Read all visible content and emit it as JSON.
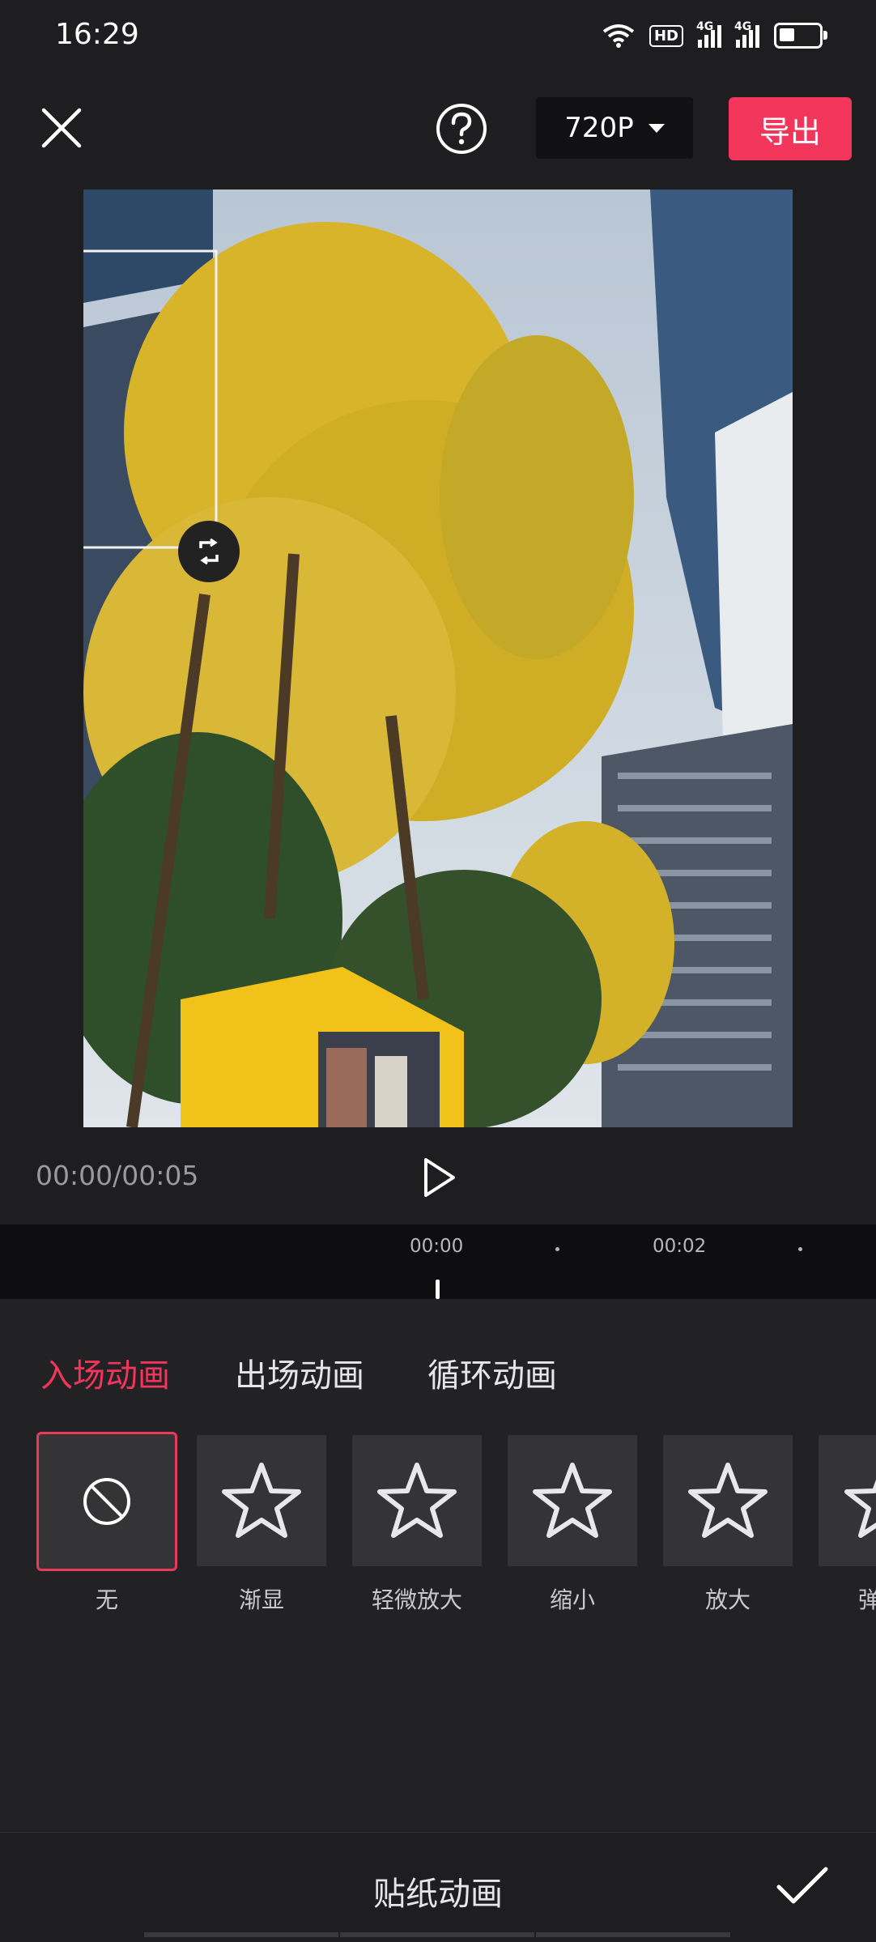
{
  "status_bar": {
    "time": "16:29",
    "hd_label": "HD",
    "signal_label": "4G"
  },
  "toolbar": {
    "quality": "720P",
    "export_label": "导出"
  },
  "player": {
    "time_display": "00:00/00:05"
  },
  "timeline": {
    "ticks": [
      "00:00",
      "00:02"
    ]
  },
  "tabs": [
    {
      "label": "入场动画",
      "active": true
    },
    {
      "label": "出场动画",
      "active": false
    },
    {
      "label": "循环动画",
      "active": false
    }
  ],
  "animations": [
    {
      "label": "无",
      "icon": "none-icon",
      "selected": true
    },
    {
      "label": "渐显",
      "icon": "star-icon",
      "selected": false
    },
    {
      "label": "轻微放大",
      "icon": "star-icon",
      "selected": false
    },
    {
      "label": "缩小",
      "icon": "star-icon",
      "selected": false
    },
    {
      "label": "放大",
      "icon": "star-icon",
      "selected": false
    },
    {
      "label": "弹",
      "icon": "star-icon",
      "selected": false
    }
  ],
  "bottom_bar": {
    "title": "贴纸动画"
  },
  "colors": {
    "accent": "#f2355b",
    "background": "#1e1e20",
    "panel": "#222224"
  }
}
